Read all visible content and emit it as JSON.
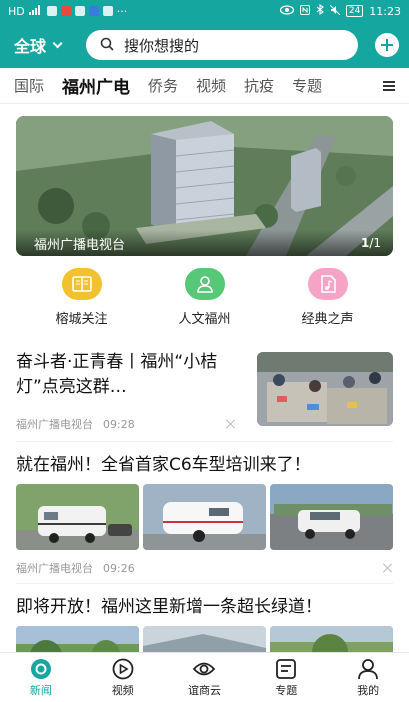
{
  "status_bar": {
    "left_text": "HD",
    "more": "···",
    "battery": "24",
    "time": "11:23"
  },
  "header": {
    "region": "全球",
    "search_placeholder": "搜你想搜的",
    "accent_color": "#16a6a0"
  },
  "tabs": [
    {
      "label": "国际",
      "active": false
    },
    {
      "label": "福州广电",
      "active": true
    },
    {
      "label": "侨务",
      "active": false
    },
    {
      "label": "视频",
      "active": false
    },
    {
      "label": "抗疫",
      "active": false
    },
    {
      "label": "专题",
      "active": false
    }
  ],
  "banner": {
    "caption": "福州广播电视台",
    "page_current": "1",
    "page_total": "/1"
  },
  "shortcuts": [
    {
      "label": "榕城关注",
      "icon": "book-icon",
      "color": "#f2c12e"
    },
    {
      "label": "人文福州",
      "icon": "person-icon",
      "color": "#57c877"
    },
    {
      "label": "经典之声",
      "icon": "music-icon",
      "color": "#f5a3c7"
    }
  ],
  "news": [
    {
      "title": "奋斗者·正青春丨福州“小桔灯”点亮这群…",
      "source": "福州广播电视台",
      "time": "09:28"
    },
    {
      "title": "就在福州！全省首家C6车型培训来了！",
      "source": "福州广播电视台",
      "time": "09:26"
    },
    {
      "title": "即将开放！福州这里新增一条超长绿道！"
    }
  ],
  "bottom_nav": [
    {
      "label": "新闻",
      "icon": "news-icon",
      "active": true
    },
    {
      "label": "视频",
      "icon": "play-icon",
      "active": false
    },
    {
      "label": "谊商云",
      "icon": "cloud-eye-icon",
      "active": false
    },
    {
      "label": "专题",
      "icon": "topic-icon",
      "active": false
    },
    {
      "label": "我的",
      "icon": "profile-icon",
      "active": false
    }
  ]
}
